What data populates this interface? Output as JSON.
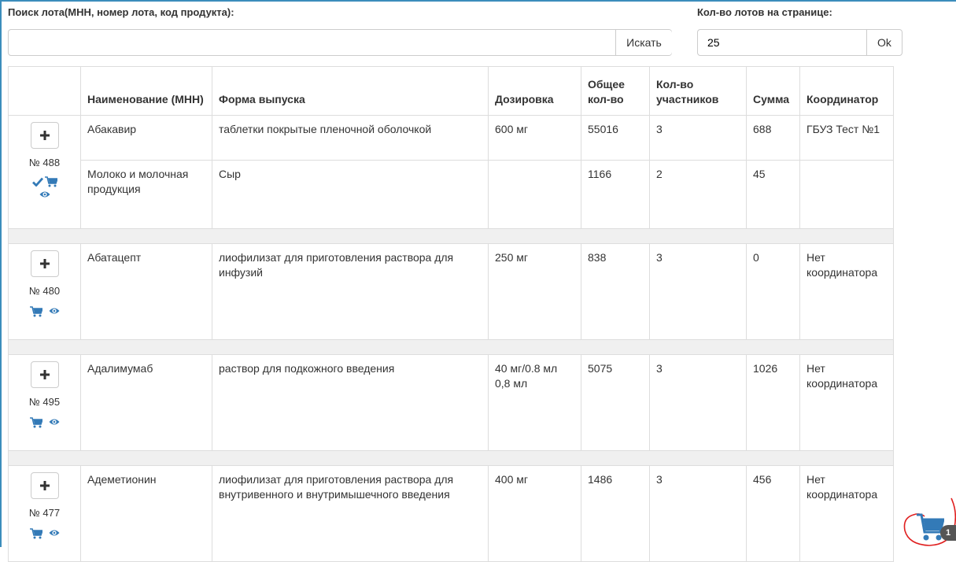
{
  "search": {
    "label": "Поиск лота(МНН, номер лота, код продукта):",
    "value": "",
    "placeholder": "",
    "button": "Искать"
  },
  "per_page": {
    "label": "Кол-во лотов на странице:",
    "value": "25",
    "button": "Ok"
  },
  "table": {
    "headers": [
      "Наименование (МНН)",
      "Форма выпуска",
      "Дозировка",
      "Общее кол-во",
      "Кол-во участников",
      "Сумма",
      "Координатор"
    ],
    "lots": [
      {
        "number": "№ 488",
        "rows": [
          {
            "name": "Абакавир",
            "form": "таблетки покрытые пленочной оболочкой",
            "dosage": "600 мг",
            "total": "55016",
            "participants": "3",
            "sum": "688",
            "coordinator": "ГБУЗ Тест №1"
          },
          {
            "name": "Молоко и молочная продукция",
            "form": "Сыр",
            "dosage": "",
            "total": "1166",
            "participants": "2",
            "sum": "45",
            "coordinator": ""
          }
        ]
      },
      {
        "number": "№ 480",
        "rows": [
          {
            "name": "Абатацепт",
            "form": "лиофилизат для приготовления раствора для инфузий",
            "dosage": "250 мг",
            "total": "838",
            "participants": "3",
            "sum": "0",
            "coordinator": "Нет координатора"
          }
        ]
      },
      {
        "number": "№ 495",
        "rows": [
          {
            "name": "Адалимумаб",
            "form": "раствор для подкожного введения",
            "dosage": "40 мг/0.8 мл 0,8 мл",
            "total": "5075",
            "participants": "3",
            "sum": "1026",
            "coordinator": "Нет координатора"
          }
        ]
      },
      {
        "number": "№ 477",
        "rows": [
          {
            "name": "Адеметионин",
            "form": "лиофилизат для приготовления раствора для внутривенного и внутримышечного введения",
            "dosage": "400 мг",
            "total": "1486",
            "participants": "3",
            "sum": "456",
            "coordinator": "Нет координатора"
          }
        ]
      }
    ]
  },
  "cart": {
    "icon": "cart-icon",
    "count": "1"
  },
  "colors": {
    "accent": "#337ab7",
    "frame": "#3c8dbc",
    "annotation": "#e02020"
  }
}
